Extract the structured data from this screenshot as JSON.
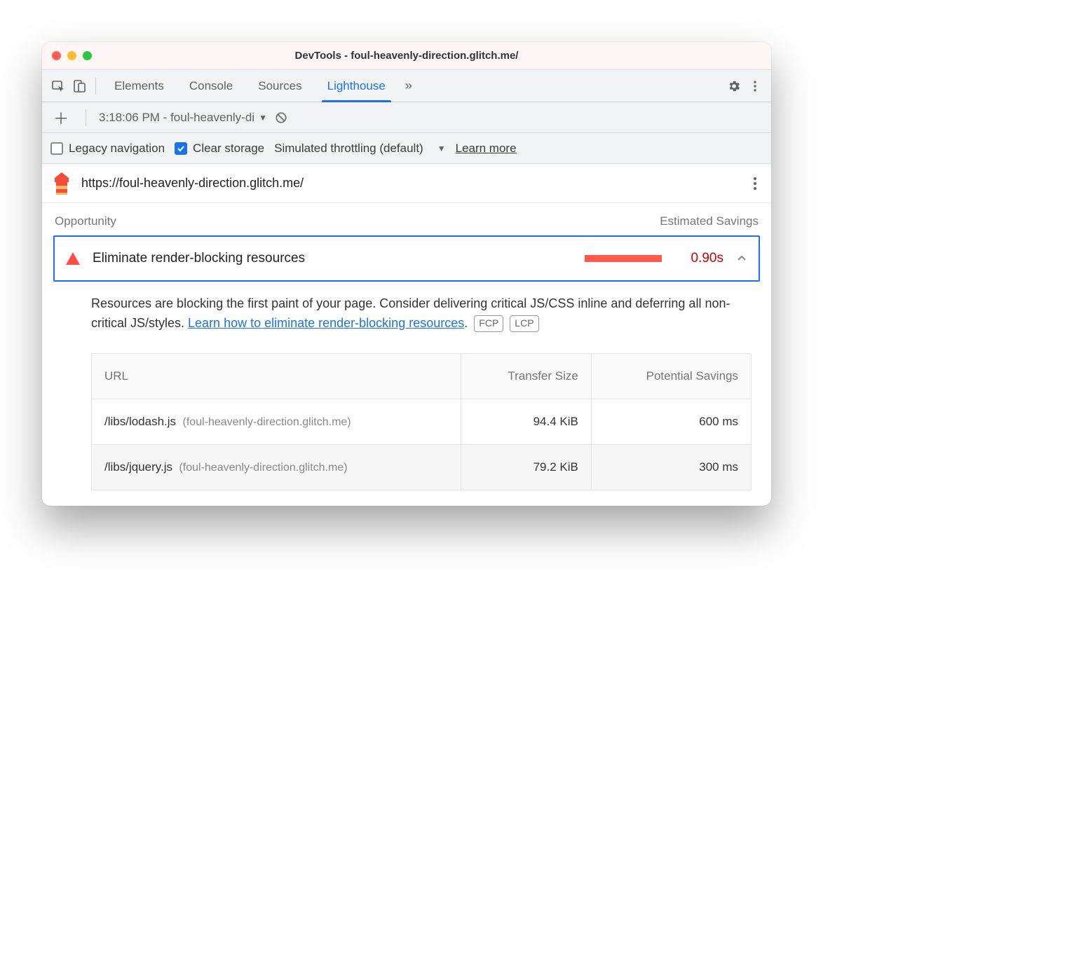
{
  "window": {
    "title": "DevTools - foul-heavenly-direction.glitch.me/"
  },
  "tabs": {
    "items": [
      {
        "label": "Elements",
        "name": "tab-elements"
      },
      {
        "label": "Console",
        "name": "tab-console"
      },
      {
        "label": "Sources",
        "name": "tab-sources"
      },
      {
        "label": "Lighthouse",
        "name": "tab-lighthouse"
      }
    ],
    "active": "Lighthouse"
  },
  "subbar": {
    "report_label": "3:18:06 PM - foul-heavenly-di"
  },
  "options": {
    "legacy_nav": {
      "label": "Legacy navigation",
      "checked": false
    },
    "clear_storage": {
      "label": "Clear storage",
      "checked": true
    },
    "throttling": "Simulated throttling (default)",
    "learn_more": "Learn more"
  },
  "urlbar": {
    "url": "https://foul-heavenly-direction.glitch.me/"
  },
  "subheader": {
    "left": "Opportunity",
    "right": "Estimated Savings"
  },
  "opportunity": {
    "title": "Eliminate render-blocking resources",
    "savings": "0.90s"
  },
  "description": {
    "text1": "Resources are blocking the first paint of your page. Consider delivering critical JS/CSS inline and deferring all non-critical JS/styles. ",
    "link": "Learn how to eliminate render-blocking resources",
    "period": ".",
    "badge1": "FCP",
    "badge2": "LCP"
  },
  "table": {
    "headers": {
      "url": "URL",
      "size": "Transfer Size",
      "savings": "Potential Savings"
    },
    "rows": [
      {
        "path": "/libs/lodash.js",
        "host": "(foul-heavenly-direction.glitch.me)",
        "size": "94.4 KiB",
        "savings": "600 ms"
      },
      {
        "path": "/libs/jquery.js",
        "host": "(foul-heavenly-direction.glitch.me)",
        "size": "79.2 KiB",
        "savings": "300 ms"
      }
    ]
  }
}
